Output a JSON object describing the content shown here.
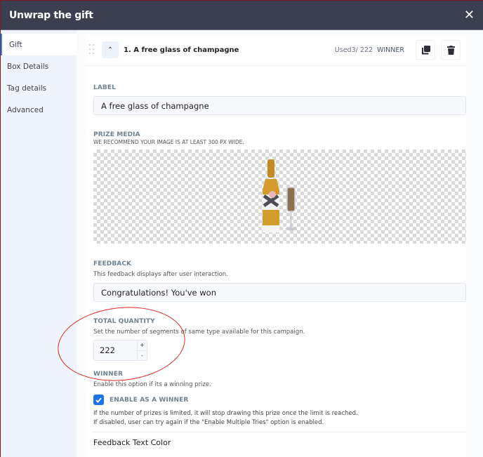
{
  "modal": {
    "title": "Unwrap the gift",
    "close_icon": "close-icon"
  },
  "sidebar": {
    "items": [
      {
        "label": "Gift",
        "active": true
      },
      {
        "label": "Box Details",
        "active": false
      },
      {
        "label": "Tag details",
        "active": false
      },
      {
        "label": "Advanced",
        "active": false
      }
    ]
  },
  "prize": {
    "title": "1. A free glass of champagne",
    "used": "Used3/ 222",
    "winner_tag": "WINNER",
    "icons": {
      "drag": "drag-handle-icon",
      "collapse": "chevron-up-icon",
      "duplicate": "copy-icon",
      "delete": "trash-icon"
    }
  },
  "form": {
    "label": {
      "title": "LABEL",
      "value": "A free glass of champagne"
    },
    "media": {
      "title": "PRIZE MEDIA",
      "hint": "WE RECOMMEND YOUR IMAGE IS AT LEAST 300 PX WIDE.",
      "image": "champagne bottle and glass"
    },
    "feedback": {
      "title": "FEEDBACK",
      "hint": "This feedback displays after user interaction.",
      "value": "Congratulations!  You've won"
    },
    "quantity": {
      "title": "TOTAL QUANTITY",
      "hint": "Set the number of segments of same type available for this campaign.",
      "value": "222",
      "plus": "+",
      "minus": "-"
    },
    "winner": {
      "title": "WINNER",
      "hint": "Enable this option if its a winning prize.",
      "checkbox_label": "ENABLE AS A WINNER",
      "checked": true,
      "note1": "If the number of prizes is limited, it will stop drawing this prize once the limit is reached.",
      "note2": "If disabled, user can try again if the \"Enable Multiple Tries\" option is enabled."
    },
    "feedback_color": {
      "title": "Feedback Text Color"
    }
  },
  "colors": {
    "header": "#3b3f50",
    "accent": "#1d74e8",
    "annotation": "#e0281f",
    "sidebar": "#f0f5fd"
  }
}
